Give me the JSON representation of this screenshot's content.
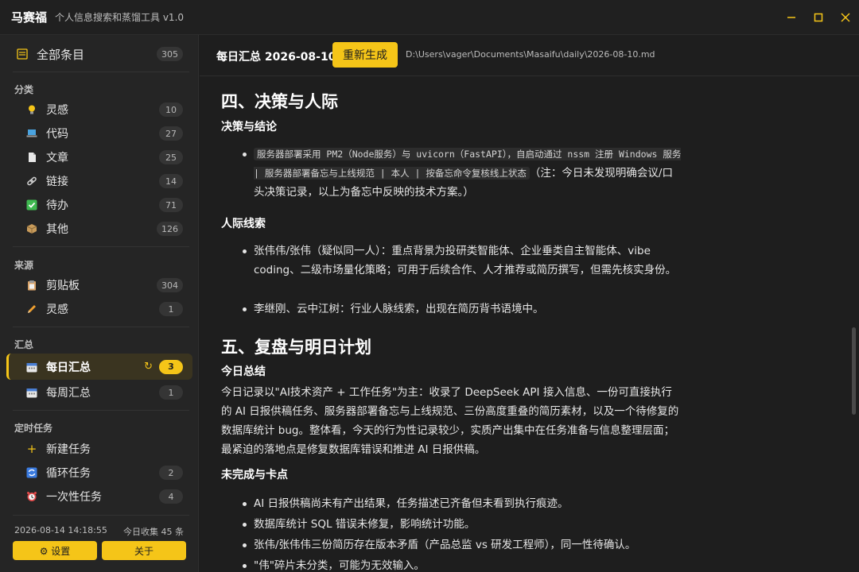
{
  "app": {
    "name": "马赛福",
    "subtitle": "个人信息搜索和蒸馏工具 v1.0"
  },
  "window_controls": [
    "minimize-icon",
    "maximize-icon",
    "close-icon"
  ],
  "sidebar": {
    "all": {
      "label": "全部条目",
      "count": "305"
    },
    "sections": {
      "category": "分类",
      "source": "来源",
      "summary": "汇总",
      "scheduled": "定时任务"
    },
    "category_items": [
      {
        "label": "灵感",
        "count": "10",
        "icon": "lightbulb-icon"
      },
      {
        "label": "代码",
        "count": "27",
        "icon": "laptop-icon"
      },
      {
        "label": "文章",
        "count": "25",
        "icon": "document-icon"
      },
      {
        "label": "链接",
        "count": "14",
        "icon": "link-icon"
      },
      {
        "label": "待办",
        "count": "71",
        "icon": "checkbox-icon"
      },
      {
        "label": "其他",
        "count": "126",
        "icon": "package-icon"
      }
    ],
    "source_items": [
      {
        "label": "剪贴板",
        "count": "304",
        "icon": "clipboard-icon"
      },
      {
        "label": "灵感",
        "count": "1",
        "icon": "pencil-icon"
      }
    ],
    "summary_items": [
      {
        "label": "每日汇总",
        "count": "3",
        "icon": "calendar-icon",
        "active": true
      },
      {
        "label": "每周汇总",
        "count": "1",
        "icon": "calendar-icon"
      }
    ],
    "task_items": [
      {
        "label": "新建任务",
        "icon": "plus-icon"
      },
      {
        "label": "循环任务",
        "count": "2",
        "icon": "repeat-icon"
      },
      {
        "label": "一次性任务",
        "count": "4",
        "icon": "alarm-clock-icon"
      }
    ],
    "footer": {
      "datetime": "2026-08-14 14:18:55",
      "today_stat": "今日收集 45 条",
      "settings_label": "⚙ 设置",
      "about_label": "关于"
    }
  },
  "main": {
    "title": "每日汇总 2026-08-10",
    "regenerate_label": "重新生成",
    "file_path": "D:\\Users\\vager\\Documents\\Masaifu\\daily\\2026-08-10.md",
    "doc": {
      "section4_title": "四、决策与人际",
      "decision_heading": "决策与结论",
      "decision_code": "服务器部署采用 PM2（Node服务）与 uvicorn（FastAPI），自启动通过 nssm 注册 Windows 服务 | 服务器部署备忘与上线规范 | 本人 | 按备忘命令复核线上状态",
      "decision_note": "（注：今日未发现明确会议/口头决策记录，以上为备忘中反映的技术方案。）",
      "people_heading": "人际线索",
      "people_items": [
        "张伟伟/张伟（疑似同一人）：重点背景为投研类智能体、企业垂类自主智能体、vibe coding、二级市场量化策略；可用于后续合作、人才推荐或简历撰写，但需先核实身份。",
        "李继刚、云中江树：行业人脉线索，出现在简历背书语境中。"
      ],
      "section5_title": "五、复盘与明日计划",
      "today_heading": "今日总结",
      "today_text": "今日记录以\"AI技术资产 + 工作任务\"为主：收录了 DeepSeek API 接入信息、一份可直接执行的 AI 日报供稿任务、服务器部署备忘与上线规范、三份高度重叠的简历素材，以及一个待修复的数据库统计 bug。整体看，今天的行为性记录较少，实质产出集中在任务准备与信息整理层面；最紧迫的落地点是修复数据库错误和推进 AI 日报供稿。",
      "blockers_heading": "未完成与卡点",
      "blocker_items": [
        "AI 日报供稿尚未有产出结果，任务描述已齐备但未看到执行痕迹。",
        "数据库统计 SQL 错误未修复，影响统计功能。",
        "张伟/张伟伟三份简历存在版本矛盾（产品总监 vs 研发工程师），同一性待确认。",
        "\"伟\"碎片未分类，可能为无效输入。"
      ]
    }
  },
  "colors": {
    "accent": "#f5c518",
    "bg": "#1e1e1e",
    "sidebar_bg": "#252525"
  }
}
